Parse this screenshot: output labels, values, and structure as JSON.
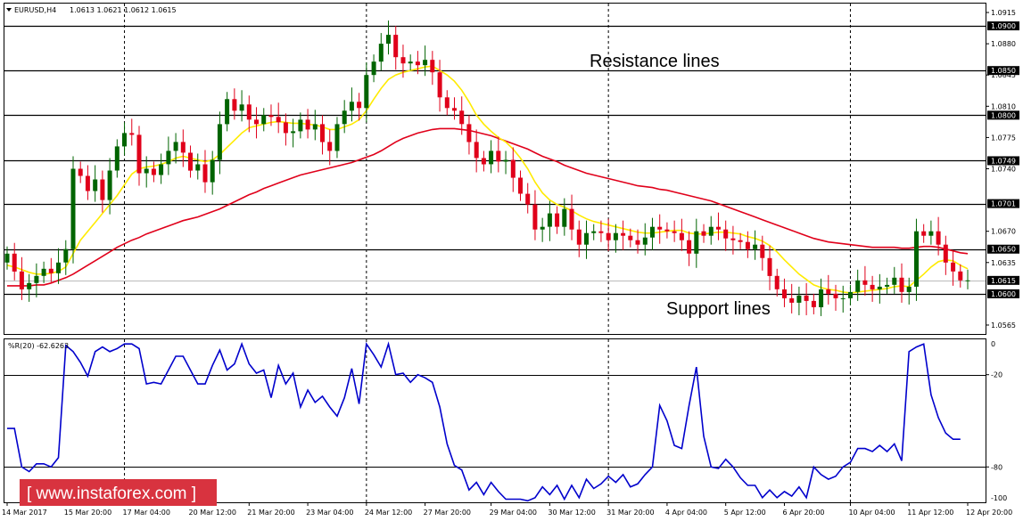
{
  "header": {
    "symbol": "EURUSD,H4",
    "ohlc": "1.0613 1.0621 1.0612 1.0615"
  },
  "annotations": {
    "resistance": "Resistance lines",
    "support": "Support lines"
  },
  "watermark": "[ www.instaforex.com ]",
  "colors": {
    "bull": "#006400",
    "bear": "#e0001a",
    "ma_fast": "#ffeb00",
    "ma_slow": "#e0001a",
    "wr": "#0000cc",
    "levels": "#000000",
    "watermark_bg": "#d8333f"
  },
  "chart_data": [
    {
      "type": "candlestick",
      "title": "EURUSD,H4",
      "ylim": [
        1.0555,
        1.0925
      ],
      "price_ticks": [
        "1.0915",
        "1.0880",
        "1.0845",
        "1.0810",
        "1.0775",
        "1.0740",
        "1.0670",
        "1.0635",
        "1.0565"
      ],
      "levels": [
        1.09,
        1.085,
        1.08,
        1.0749,
        1.0701,
        1.065,
        1.06
      ],
      "level_labels": [
        "1.0900",
        "1.0850",
        "1.0800",
        "1.0749",
        "1.0701",
        "1.0650",
        "1.0600"
      ],
      "current_price": 1.0615,
      "current_label": "1.0615",
      "close": [
        1.0645,
        1.0625,
        1.0605,
        1.0612,
        1.062,
        1.0628,
        1.0623,
        1.0635,
        1.065,
        1.074,
        1.0732,
        1.0715,
        1.0728,
        1.0705,
        1.0738,
        1.0765,
        1.078,
        1.0778,
        1.0735,
        1.074,
        1.0733,
        1.0745,
        1.076,
        1.077,
        1.0758,
        1.0738,
        1.0745,
        1.0725,
        1.075,
        1.079,
        1.0818,
        1.0805,
        1.0812,
        1.0795,
        1.079,
        1.08,
        1.0798,
        1.0792,
        1.078,
        1.0782,
        1.0795,
        1.0784,
        1.079,
        1.077,
        1.076,
        1.079,
        1.0805,
        1.0815,
        1.0808,
        1.0845,
        1.086,
        1.088,
        1.089,
        1.0865,
        1.0858,
        1.086,
        1.0856,
        1.0862,
        1.0848,
        1.082,
        1.0808,
        1.0805,
        1.079,
        1.077,
        1.0752,
        1.0745,
        1.076,
        1.0748,
        1.075,
        1.073,
        1.0712,
        1.07,
        1.0672,
        1.0675,
        1.069,
        1.0675,
        1.0695,
        1.0672,
        1.0655,
        1.0668,
        1.067,
        1.0668,
        1.066,
        1.0668,
        1.0665,
        1.066,
        1.0655,
        1.0663,
        1.0675,
        1.0672,
        1.067,
        1.0668,
        1.066,
        1.0645,
        1.067,
        1.0665,
        1.0675,
        1.0672,
        1.0662,
        1.066,
        1.0658,
        1.065,
        1.0655,
        1.064,
        1.062,
        1.0605,
        1.0595,
        1.059,
        1.0598,
        1.0592,
        1.0585,
        1.0605,
        1.06,
        1.0595,
        1.0595,
        1.0602,
        1.0615,
        1.061,
        1.0605,
        1.0608,
        1.061,
        1.0618,
        1.0602,
        1.0608,
        1.067,
        1.0665,
        1.067,
        1.0655,
        1.0635,
        1.0625,
        1.0615,
        1.0615
      ],
      "ma_fast": [
        1.0632,
        1.063,
        1.0627,
        1.0624,
        1.0622,
        1.0622,
        1.0623,
        1.0625,
        1.063,
        1.0645,
        1.066,
        1.067,
        1.068,
        1.069,
        1.07,
        1.071,
        1.0722,
        1.0734,
        1.074,
        1.0742,
        1.0743,
        1.0745,
        1.0748,
        1.0752,
        1.0754,
        1.0752,
        1.075,
        1.0748,
        1.075,
        1.0756,
        1.0764,
        1.0772,
        1.078,
        1.0786,
        1.0788,
        1.079,
        1.0792,
        1.0793,
        1.0792,
        1.0791,
        1.0791,
        1.079,
        1.0789,
        1.0787,
        1.0784,
        1.0784,
        1.0787,
        1.079,
        1.0795,
        1.0805,
        1.0818,
        1.083,
        1.084,
        1.0845,
        1.0848,
        1.085,
        1.0852,
        1.0854,
        1.0855,
        1.085,
        1.0845,
        1.0838,
        1.0828,
        1.0815,
        1.08,
        1.079,
        1.0782,
        1.0775,
        1.077,
        1.0762,
        1.0752,
        1.074,
        1.0725,
        1.0713,
        1.0705,
        1.07,
        1.0697,
        1.0693,
        1.0688,
        1.0684,
        1.0681,
        1.0679,
        1.0677,
        1.0675,
        1.0673,
        1.0671,
        1.0669,
        1.0668,
        1.0668,
        1.0669,
        1.067,
        1.0671,
        1.0671,
        1.0668,
        1.0667,
        1.0667,
        1.0668,
        1.0669,
        1.0669,
        1.0668,
        1.0667,
        1.0664,
        1.0662,
        1.0659,
        1.0654,
        1.0647,
        1.0638,
        1.063,
        1.0622,
        1.0616,
        1.061,
        1.0607,
        1.0605,
        1.0604,
        1.0602,
        1.0601,
        1.0602,
        1.0603,
        1.0604,
        1.0605,
        1.0606,
        1.0608,
        1.0609,
        1.0608,
        1.0615,
        1.0622,
        1.063,
        1.0636,
        1.0638,
        1.0637,
        1.0632,
        1.0628
      ],
      "ma_slow": [
        1.0609,
        1.0609,
        1.0609,
        1.0609,
        1.061,
        1.061,
        1.0612,
        1.0615,
        1.0618,
        1.0622,
        1.0627,
        1.0632,
        1.0637,
        1.0642,
        1.0647,
        1.0652,
        1.0656,
        1.066,
        1.0663,
        1.0667,
        1.067,
        1.0673,
        1.0676,
        1.0679,
        1.0682,
        1.0684,
        1.0686,
        1.0689,
        1.0692,
        1.0695,
        1.0699,
        1.0703,
        1.0707,
        1.0711,
        1.0714,
        1.0718,
        1.0721,
        1.0724,
        1.0727,
        1.073,
        1.0733,
        1.0735,
        1.0737,
        1.0739,
        1.0741,
        1.0743,
        1.0745,
        1.0747,
        1.075,
        1.0753,
        1.0756,
        1.076,
        1.0765,
        1.077,
        1.0774,
        1.0777,
        1.078,
        1.0782,
        1.0784,
        1.0785,
        1.0785,
        1.0785,
        1.0784,
        1.0783,
        1.0781,
        1.0779,
        1.0777,
        1.0774,
        1.0771,
        1.0768,
        1.0765,
        1.0762,
        1.0758,
        1.0754,
        1.0751,
        1.0748,
        1.0744,
        1.0741,
        1.0738,
        1.0735,
        1.0733,
        1.0731,
        1.0729,
        1.0727,
        1.0725,
        1.0723,
        1.0721,
        1.072,
        1.0719,
        1.0717,
        1.0716,
        1.0714,
        1.0712,
        1.071,
        1.0708,
        1.0706,
        1.0704,
        1.0701,
        1.0698,
        1.0695,
        1.0692,
        1.0689,
        1.0686,
        1.0683,
        1.068,
        1.0677,
        1.0674,
        1.0671,
        1.0668,
        1.0665,
        1.0662,
        1.066,
        1.0658,
        1.0657,
        1.0656,
        1.0655,
        1.0654,
        1.0653,
        1.0652,
        1.0652,
        1.0652,
        1.0652,
        1.0651,
        1.0651,
        1.0652,
        1.0653,
        1.0653,
        1.0652,
        1.065,
        1.0648,
        1.0646,
        1.0645
      ]
    },
    {
      "type": "line",
      "title": "%R(20) -62.6263",
      "ylim": [
        -103,
        3
      ],
      "y_ticks": [
        "0",
        "-100"
      ],
      "levels": [
        -20,
        -80
      ],
      "level_labels": [
        "-20",
        "-80"
      ],
      "values": [
        -55,
        -55,
        -80,
        -83,
        -78,
        -78,
        -80,
        -74,
        -1,
        -5,
        -12,
        -21,
        -5,
        -2,
        -5,
        -3,
        0,
        0,
        -3,
        -26,
        -25,
        -26,
        -17,
        -8,
        -8,
        -17,
        -26,
        -26,
        -14,
        -4,
        -17,
        -13,
        0,
        -13,
        -19,
        -17,
        -35,
        -14,
        -26,
        -19,
        -41,
        -30,
        -38,
        -34,
        -41,
        -47,
        -35,
        -16,
        -39,
        0,
        -7,
        -15,
        0,
        -20,
        -19,
        -25,
        -20,
        -22,
        -25,
        -41,
        -65,
        -79,
        -82,
        -95,
        -90,
        -98,
        -90,
        -96,
        -101,
        -101,
        -101,
        -102,
        -100,
        -93,
        -98,
        -92,
        -101,
        -92,
        -100,
        -88,
        -94,
        -91,
        -86,
        -90,
        -85,
        -93,
        -91,
        -85,
        -80,
        -40,
        -50,
        -66,
        -68,
        -40,
        -15,
        -60,
        -80,
        -81,
        -75,
        -80,
        -87,
        -92,
        -92,
        -100,
        -95,
        -100,
        -96,
        -99,
        -93,
        -100,
        -80,
        -85,
        -88,
        -86,
        -80,
        -77,
        -68,
        -68,
        -70,
        -66,
        -70,
        -65,
        -76,
        -5,
        -2,
        0,
        -33,
        -48,
        -58,
        -62,
        -62
      ]
    }
  ],
  "x_labels": [
    "14 Mar 2017",
    "15 Mar 20:00",
    "17 Mar 04:00",
    "20 Mar 12:00",
    "21 Mar 20:00",
    "23 Mar 04:00",
    "24 Mar 12:00",
    "27 Mar 20:00",
    "29 Mar 04:00",
    "30 Mar 12:00",
    "31 Mar 20:00",
    "4 Apr 04:00",
    "5 Apr 12:00",
    "6 Apr 20:00",
    "10 Apr 04:00",
    "11 Apr 12:00",
    "12 Apr 20:00"
  ],
  "period_separator_labels": [
    "17 Mar 04:00",
    "24 Mar 12:00",
    "31 Mar 20:00",
    "10 Apr 04:00"
  ]
}
